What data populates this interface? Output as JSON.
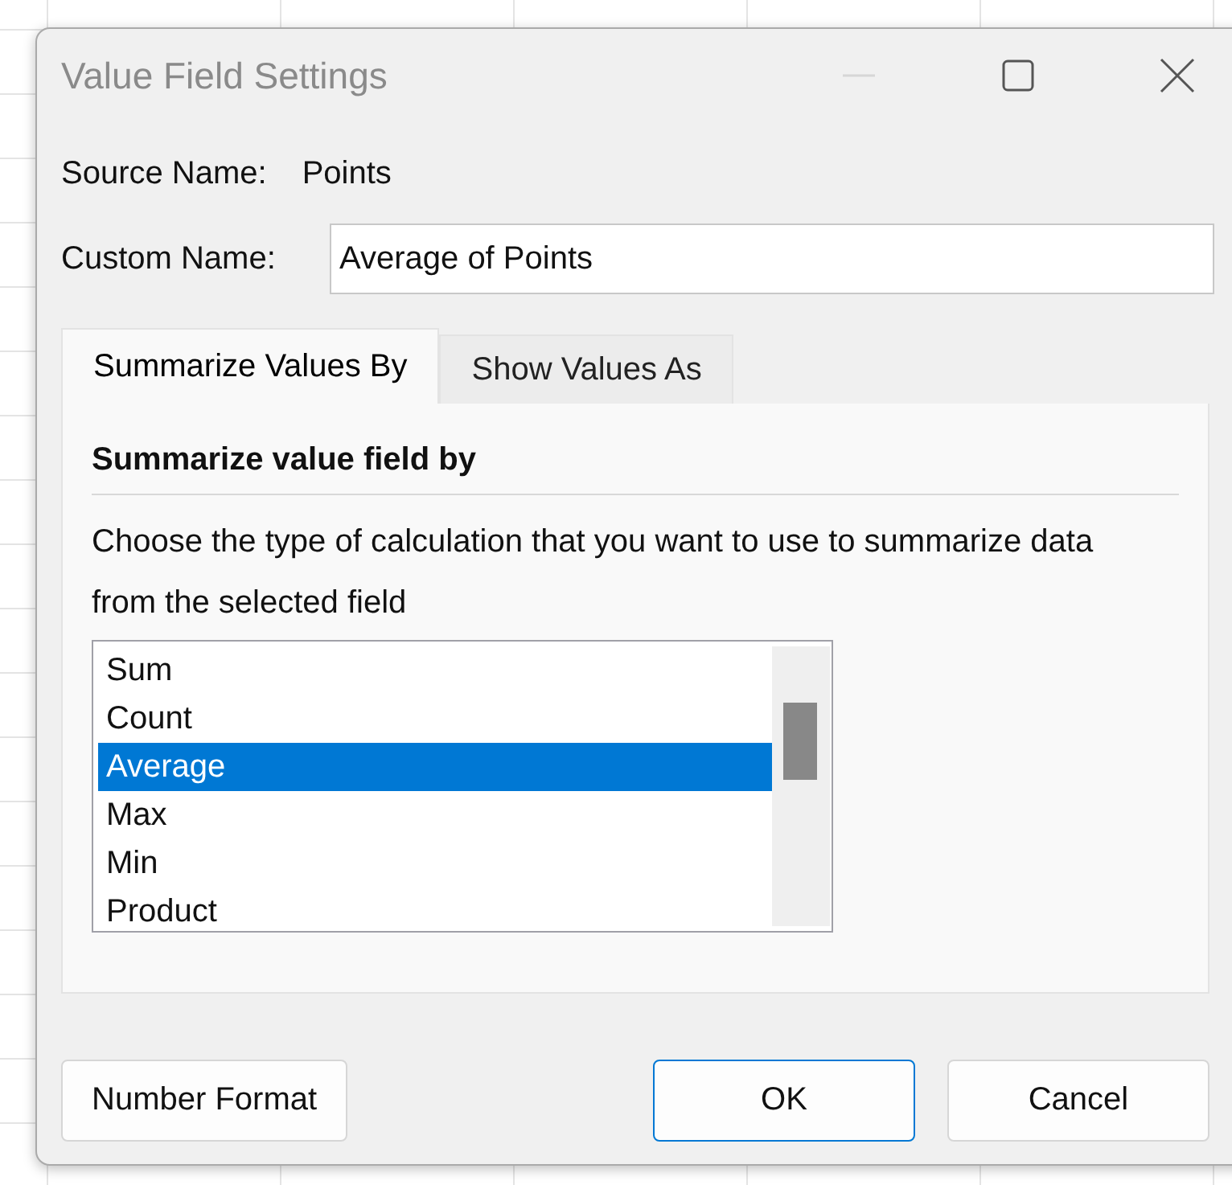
{
  "window": {
    "title": "Value Field Settings"
  },
  "source_name": {
    "label": "Source Name:",
    "value": "Points"
  },
  "custom_name": {
    "label": "Custom Name:",
    "value": "Average of Points"
  },
  "tabs": [
    {
      "label": "Summarize Values By",
      "selected": true
    },
    {
      "label": "Show Values As",
      "selected": false
    }
  ],
  "section": {
    "heading": "Summarize value field by",
    "description": "Choose the type of calculation that you want to use to summarize data from the selected field"
  },
  "calculations": [
    {
      "label": "Sum",
      "selected": false
    },
    {
      "label": "Count",
      "selected": false
    },
    {
      "label": "Average",
      "selected": true
    },
    {
      "label": "Max",
      "selected": false
    },
    {
      "label": "Min",
      "selected": false
    },
    {
      "label": "Product",
      "selected": false
    }
  ],
  "buttons": [
    {
      "label": "Number Format",
      "default": false
    },
    {
      "label": "OK",
      "default": true
    },
    {
      "label": "Cancel",
      "default": false
    }
  ]
}
